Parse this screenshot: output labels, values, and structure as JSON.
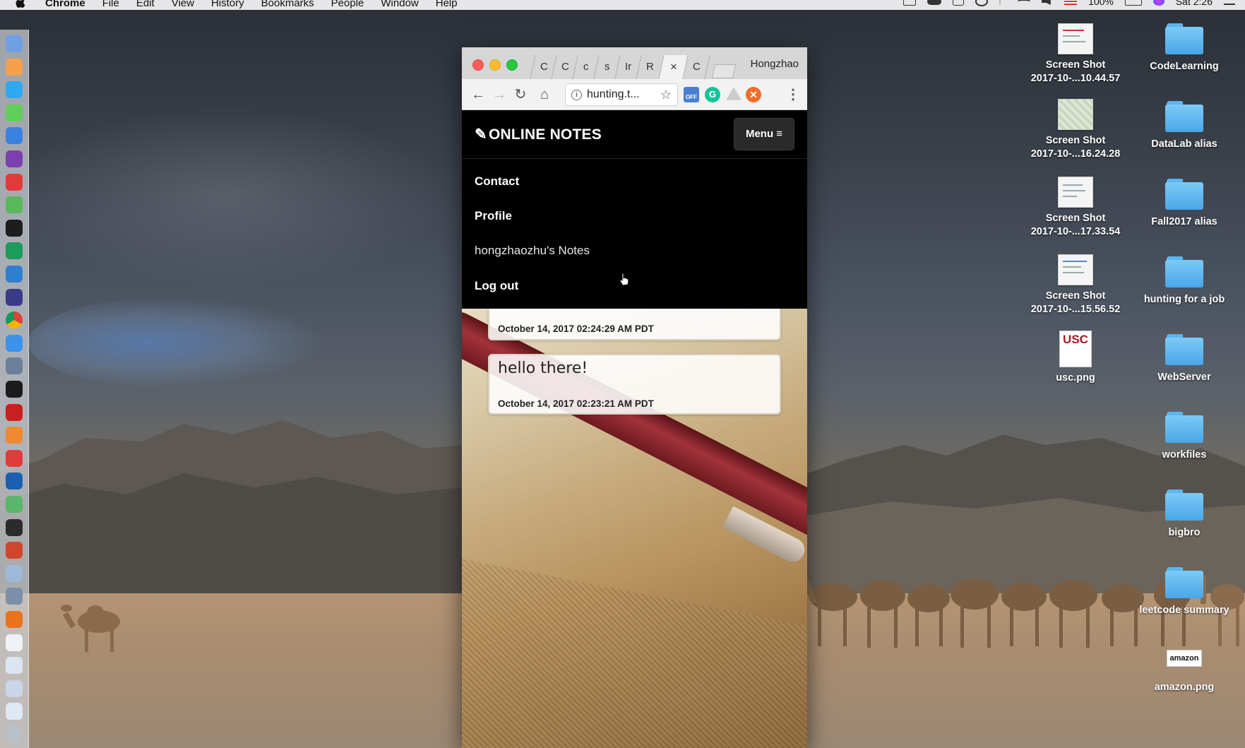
{
  "menubar": {
    "app_name": "Chrome",
    "items": [
      "File",
      "Edit",
      "View",
      "History",
      "Bookmarks",
      "People",
      "Window",
      "Help"
    ],
    "battery": "100%",
    "clock": "Sat 2:26"
  },
  "dock": {
    "icons": [
      "finder-icon",
      "photos-icon",
      "messages-icon",
      "wechat-icon",
      "baidu-icon",
      "onenote-icon",
      "netease-music-icon",
      "app-icon",
      "intellij-icon",
      "pycharm-icon",
      "vscode-icon",
      "eclipse-icon",
      "chrome-icon",
      "safari-icon",
      "virtualbox-icon",
      "terminal-icon",
      "filezilla-icon",
      "sublime-icon",
      "youdao-icon",
      "quicktime-icon",
      "app-icon-2",
      "activity-monitor-icon",
      "powerpoint-icon",
      "preview-icon",
      "app-icon-3",
      "firefox-icon",
      "documents-icon",
      "downloads-icon",
      "stack-icon",
      "stack-icon-2",
      "trash-icon"
    ]
  },
  "desktop": {
    "files": [
      {
        "label_line1": "Screen Shot",
        "label_line2": "2017-10-...10.44.57"
      },
      {
        "label_line1": "Screen Shot",
        "label_line2": "2017-10-...16.24.28"
      },
      {
        "label_line1": "Screen Shot",
        "label_line2": "2017-10-...17.33.54"
      },
      {
        "label_line1": "Screen Shot",
        "label_line2": "2017-10-...15.56.52"
      },
      {
        "label_line1": "usc.png",
        "label_line2": ""
      }
    ],
    "folders": [
      "CodeLearning",
      "DataLab alias",
      "Fall2017 alias",
      "hunting for a job",
      "WebServer",
      "workfiles",
      "bigbro",
      "leetcode summary"
    ],
    "amazon_label": "amazon.png",
    "usc_logo_text": "USC",
    "amazon_logo_text": "amazon"
  },
  "browser": {
    "tabs": [
      "C",
      "C",
      "c",
      "s",
      "Ir",
      "R",
      "×",
      "C"
    ],
    "profile_name": "Hongzhao",
    "url": "hunting.t...",
    "ext_off_label": "OFF"
  },
  "page": {
    "brand": "ONLINE NOTES",
    "menu_button": "Menu ≡",
    "menu_items": [
      "Contact",
      "Profile",
      "hongzhaozhu's Notes",
      "Log out"
    ],
    "notes": [
      {
        "text": "",
        "date": "October 14, 2017 02:24:29 AM PDT"
      },
      {
        "text": "hello there!",
        "date": "October 14, 2017 02:23:21 AM PDT"
      }
    ]
  },
  "colors": {
    "navbar": "#000000",
    "menu_button": "#2a2a2a",
    "folder_blue": "#5ab6f0"
  }
}
